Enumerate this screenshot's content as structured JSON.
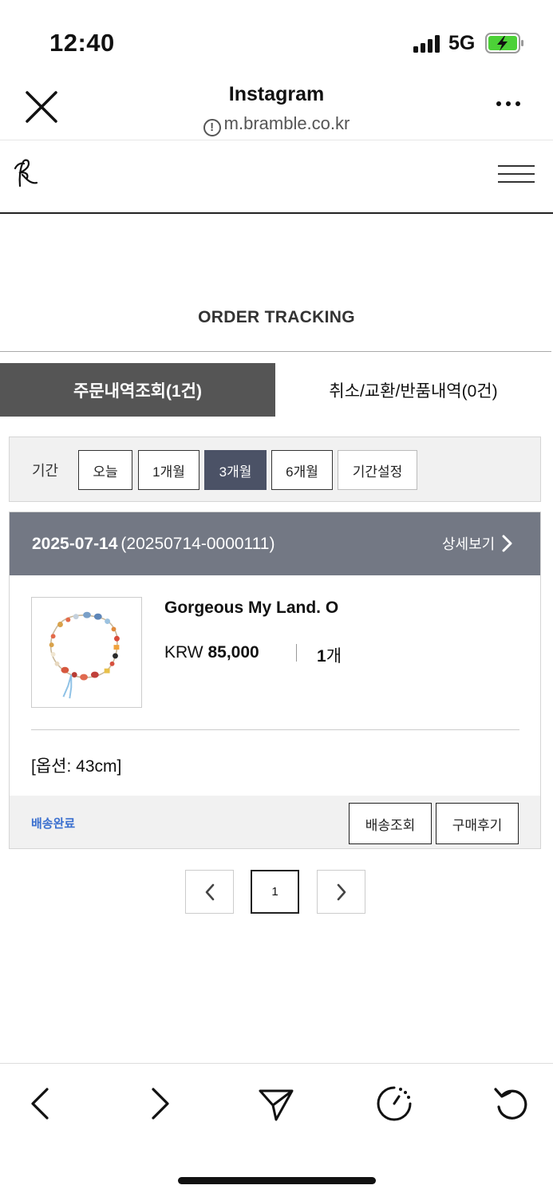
{
  "status_bar": {
    "time": "12:40",
    "network": "5G"
  },
  "browser": {
    "title": "Instagram",
    "url": "m.bramble.co.kr"
  },
  "page": {
    "title": "ORDER TRACKING"
  },
  "tabs": [
    {
      "label": "주문내역조회(1건)",
      "active": true
    },
    {
      "label": "취소/교환/반품내역(0건)",
      "active": false
    }
  ],
  "period": {
    "label": "기간",
    "options": [
      "오늘",
      "1개월",
      "3개월",
      "6개월",
      "기간설정"
    ],
    "selected": "3개월"
  },
  "order": {
    "date": "2025-07-14",
    "number": "(20250714-0000111)",
    "detail_label": "상세보기",
    "product_name": "Gorgeous My Land. O",
    "currency": "KRW",
    "price": "85,000",
    "quantity_value": "1",
    "quantity_unit": "개",
    "option": "[옵션: 43cm]",
    "status": "배송완료",
    "actions": [
      "배송조회",
      "구매후기"
    ]
  },
  "pagination": {
    "current": "1"
  },
  "colors": {
    "tab_active": "#555555",
    "period_selected": "#4b5266",
    "order_header": "#737884",
    "status_link": "#3a6fcf",
    "battery_charging": "#4cd137"
  }
}
